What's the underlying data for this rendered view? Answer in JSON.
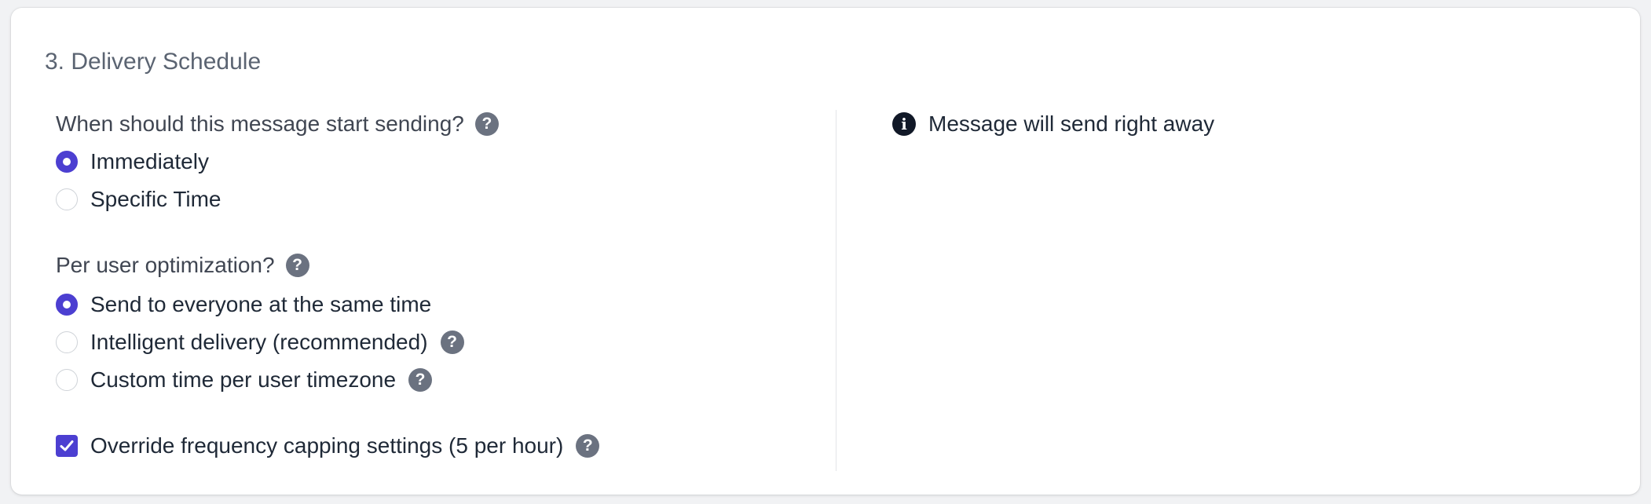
{
  "section": {
    "title": "3. Delivery Schedule"
  },
  "start": {
    "question": "When should this message start sending?",
    "options": [
      {
        "label": "Immediately",
        "selected": true
      },
      {
        "label": "Specific Time",
        "selected": false
      }
    ]
  },
  "optimization": {
    "question": "Per user optimization?",
    "options": [
      {
        "label": "Send to everyone at the same time",
        "selected": true
      },
      {
        "label": "Intelligent delivery (recommended)",
        "selected": false
      },
      {
        "label": "Custom time per user timezone",
        "selected": false
      }
    ]
  },
  "override": {
    "label": "Override frequency capping settings (5 per hour)",
    "checked": true
  },
  "info": {
    "text": "Message will send right away"
  },
  "icons": {
    "help": "?",
    "info": "i"
  },
  "colors": {
    "accent": "#4c3fd1",
    "help_icon_bg": "#6b7280",
    "info_icon_bg": "#111827"
  }
}
